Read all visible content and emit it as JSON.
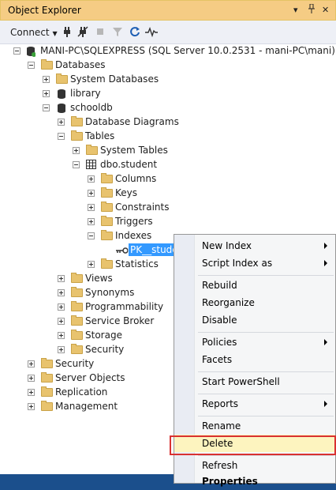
{
  "panel": {
    "title": "Object Explorer"
  },
  "title_buttons": {
    "dropdown": "▾",
    "pin": "✈",
    "close": "✕"
  },
  "toolbar": {
    "connect_label": "Connect",
    "icons": [
      "connect-dropdown-icon",
      "connect-icon",
      "disconnect-icon",
      "stop-icon",
      "filter-icon",
      "refresh-icon",
      "activity-monitor-icon"
    ]
  },
  "tree": {
    "server": "MANI-PC\\SQLEXPRESS (SQL Server 10.0.2531 - mani-PC\\mani)",
    "databases": "Databases",
    "system_databases": "System Databases",
    "library": "library",
    "schooldb": "schooldb",
    "database_diagrams": "Database Diagrams",
    "tables": "Tables",
    "system_tables": "System Tables",
    "dbo_student": "dbo.student",
    "columns": "Columns",
    "keys": "Keys",
    "constraints": "Constraints",
    "triggers": "Triggers",
    "indexes": "Indexes",
    "pk_student": "PK__studen",
    "statistics": "Statistics",
    "views": "Views",
    "synonyms": "Synonyms",
    "programmability": "Programmability",
    "service_broker": "Service Broker",
    "storage": "Storage",
    "security_db": "Security",
    "security": "Security",
    "server_objects": "Server Objects",
    "replication": "Replication",
    "management": "Management"
  },
  "context_menu": {
    "new_index": "New Index",
    "script_index_as": "Script Index as",
    "rebuild": "Rebuild",
    "reorganize": "Reorganize",
    "disable": "Disable",
    "policies": "Policies",
    "facets": "Facets",
    "start_powershell": "Start PowerShell",
    "reports": "Reports",
    "rename": "Rename",
    "delete": "Delete",
    "refresh": "Refresh",
    "properties": "Properties"
  },
  "colors": {
    "titlebar": "#f5cc84",
    "selection": "#3399ff",
    "menu_highlight": "#fdf4bf",
    "highlight_border": "#d93131"
  }
}
